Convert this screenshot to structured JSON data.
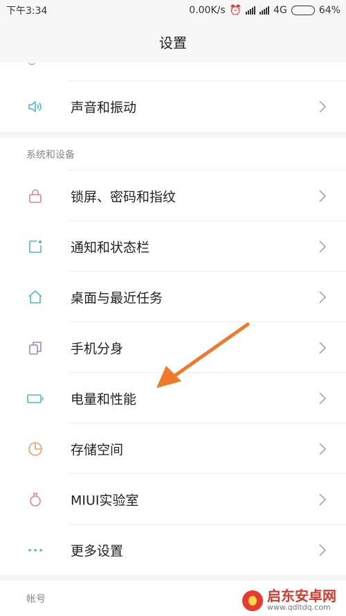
{
  "status_bar": {
    "time": "下午3:34",
    "speed": "0.00K/s",
    "network": "4G",
    "battery_percent": "64%",
    "battery_level": 0.64
  },
  "header": {
    "title": "设置"
  },
  "rows_top": [
    {
      "label": "声音和振动",
      "icon": "speaker-icon",
      "color": "#4fb7c9"
    }
  ],
  "section_system": {
    "title": "系统和设备",
    "items": [
      {
        "label": "锁屏、密码和指纹",
        "icon": "lock-icon",
        "color": "#d9858d"
      },
      {
        "label": "通知和状态栏",
        "icon": "notification-icon",
        "color": "#4fb7c9"
      },
      {
        "label": "桌面与最近任务",
        "icon": "home-icon",
        "color": "#4fb7c9"
      },
      {
        "label": "手机分身",
        "icon": "dual-apps-icon",
        "color": "#9a86c9"
      },
      {
        "label": "电量和性能",
        "icon": "battery-icon",
        "color": "#4fb7c9"
      },
      {
        "label": "存储空间",
        "icon": "storage-icon",
        "color": "#e8a071"
      },
      {
        "label": "MIUI实验室",
        "icon": "lab-flask-icon",
        "color": "#d9858d"
      },
      {
        "label": "更多设置",
        "icon": "more-dots-icon",
        "color": "#4fb7c9"
      }
    ]
  },
  "section_account": {
    "title": "帐号"
  },
  "annotation": {
    "arrow_color": "#f07a2a"
  },
  "watermark": {
    "title": "启东安卓网",
    "url": "www.qdltdq.com"
  }
}
